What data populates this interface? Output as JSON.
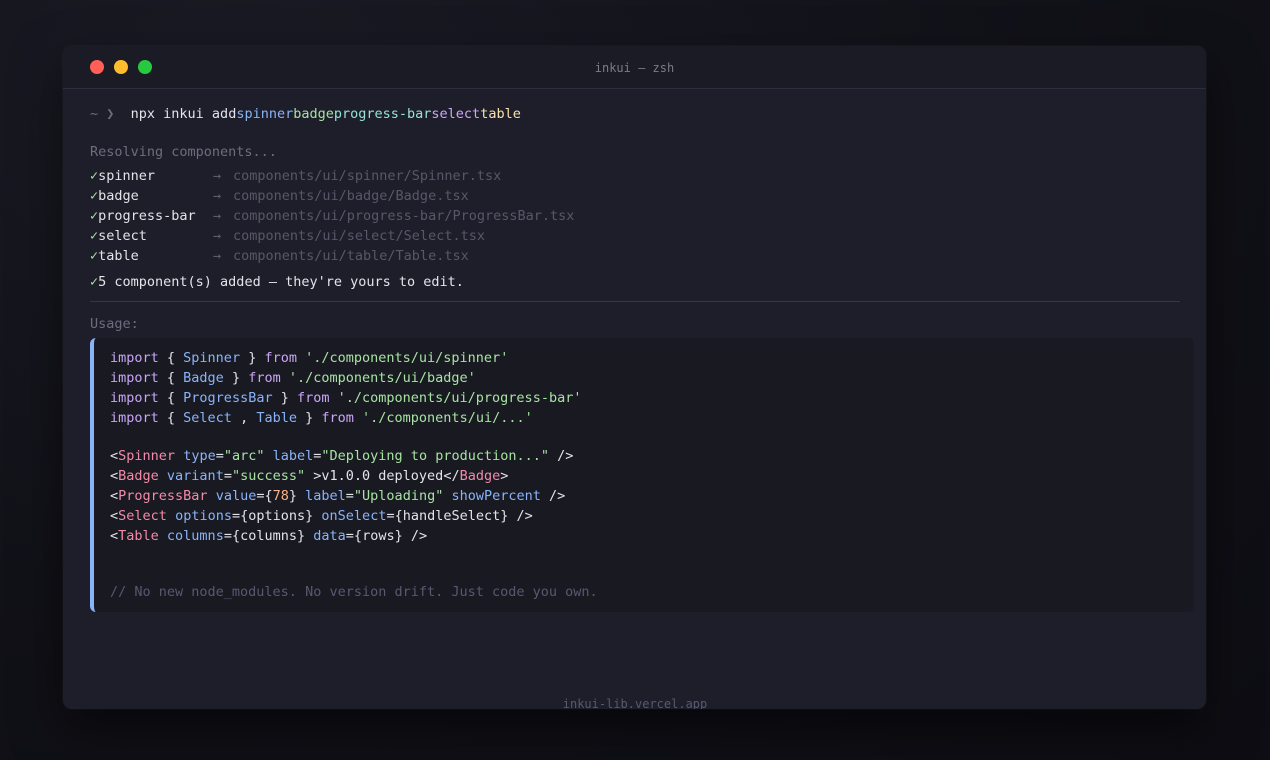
{
  "window": {
    "title": "inkui — zsh"
  },
  "prompt": {
    "symbol": "~ ❯",
    "command": "npx inkui add",
    "args": [
      "spinner",
      "badge",
      "progress-bar",
      "select",
      "table"
    ]
  },
  "resolving": "Resolving components...",
  "components": [
    {
      "check": "✓",
      "name": "spinner",
      "arrow": "→",
      "path": "components/ui/spinner/Spinner.tsx"
    },
    {
      "check": "✓",
      "name": "badge",
      "arrow": "→",
      "path": "components/ui/badge/Badge.tsx"
    },
    {
      "check": "✓",
      "name": "progress-bar",
      "arrow": "→",
      "path": "components/ui/progress-bar/ProgressBar.tsx"
    },
    {
      "check": "✓",
      "name": "select",
      "arrow": "→",
      "path": "components/ui/select/Select.tsx"
    },
    {
      "check": "✓",
      "name": "table",
      "arrow": "→",
      "path": "components/ui/table/Table.tsx"
    }
  ],
  "summary": {
    "check": "✓",
    "text": "5 component(s) added — they're yours to edit."
  },
  "usage_label": "Usage:",
  "code": {
    "imports": [
      {
        "kw": "import",
        "open": " { ",
        "names": [
          "Spinner"
        ],
        "close": " } ",
        "from": "from",
        "path": "'./components/ui/spinner'"
      },
      {
        "kw": "import",
        "open": " { ",
        "names": [
          "Badge"
        ],
        "close": " } ",
        "from": "from",
        "path": "'./components/ui/badge'"
      },
      {
        "kw": "import",
        "open": " { ",
        "names": [
          "ProgressBar"
        ],
        "close": " } ",
        "from": "from",
        "path": "'./components/ui/progress-bar'"
      },
      {
        "kw": "import",
        "open": " { ",
        "names": [
          "Select",
          "Table"
        ],
        "close": " } ",
        "from": "from",
        "path": "'./components/ui/...'"
      }
    ],
    "jsx": {
      "spinner": {
        "tag": "Spinner",
        "a1": "type",
        "v1": "\"arc\"",
        "a2": "label",
        "v2": "\"Deploying to production...\""
      },
      "badge": {
        "tag": "Badge",
        "a1": "variant",
        "v1": "\"success\"",
        "text": "v1.0.0 deployed"
      },
      "progress": {
        "tag": "ProgressBar",
        "a1": "value",
        "v1": "78",
        "a2": "label",
        "v2": "\"Uploading\"",
        "a3": "showPercent"
      },
      "select": {
        "tag": "Select",
        "a1": "options",
        "v1": "options",
        "a2": "onSelect",
        "v2": "handleSelect"
      },
      "table": {
        "tag": "Table",
        "a1": "columns",
        "v1": "columns",
        "a2": "data",
        "v2": "rows"
      }
    },
    "comment": "// No new node_modules. No version drift. Just code you own."
  },
  "footer": "inkui-lib.vercel.app",
  "colors": {
    "background": "#111118",
    "window": "#1e1e2a",
    "accent": "#89b4fa",
    "close": "#ff5f56",
    "minimize": "#ffbd2e",
    "maximize": "#27c93f"
  }
}
